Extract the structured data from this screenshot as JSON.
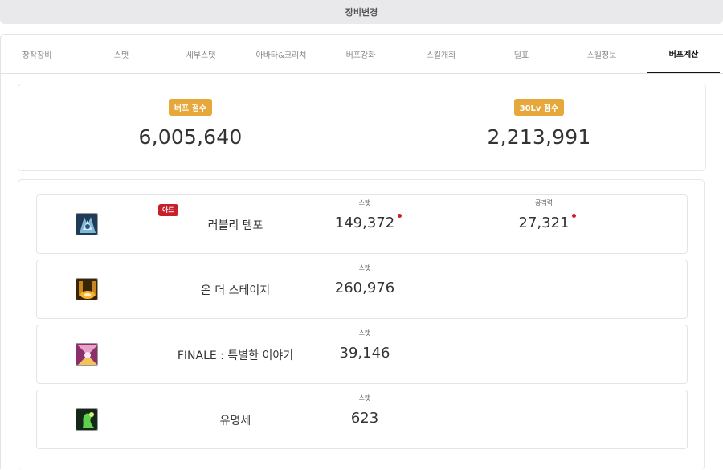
{
  "header": {
    "title": "장비변경"
  },
  "tabs": [
    {
      "label": "장착장비",
      "active": false
    },
    {
      "label": "스탯",
      "active": false
    },
    {
      "label": "세부스탯",
      "active": false
    },
    {
      "label": "아바타&크리쳐",
      "active": false
    },
    {
      "label": "버프강화",
      "active": false
    },
    {
      "label": "스킬개화",
      "active": false
    },
    {
      "label": "딜표",
      "active": false
    },
    {
      "label": "스킬정보",
      "active": false
    },
    {
      "label": "버프계산",
      "active": true
    }
  ],
  "scores": {
    "buff": {
      "label": "버프 점수",
      "value": "6,005,640"
    },
    "lv30": {
      "label": "30Lv 점수",
      "value": "2,213,991"
    }
  },
  "skills": [
    {
      "name": "러블리 템포",
      "tag": "아드",
      "icon": "lovely-tempo-icon",
      "stats": [
        {
          "label": "스탯",
          "value": "149,372",
          "changed": true
        },
        {
          "label": "공격력",
          "value": "27,321",
          "changed": true
        }
      ]
    },
    {
      "name": "온 더 스테이지",
      "icon": "on-the-stage-icon",
      "stats": [
        {
          "label": "스탯",
          "value": "260,976"
        }
      ]
    },
    {
      "name": "FINALE : 특별한 이야기",
      "icon": "finale-icon",
      "stats": [
        {
          "label": "스탯",
          "value": "39,146"
        }
      ]
    },
    {
      "name": "유명세",
      "icon": "fame-icon",
      "stats": [
        {
          "label": "스탯",
          "value": "623"
        }
      ]
    }
  ],
  "colors": {
    "badge": "#e6a83a",
    "tag": "#c8202a",
    "dot": "#d01c24"
  }
}
